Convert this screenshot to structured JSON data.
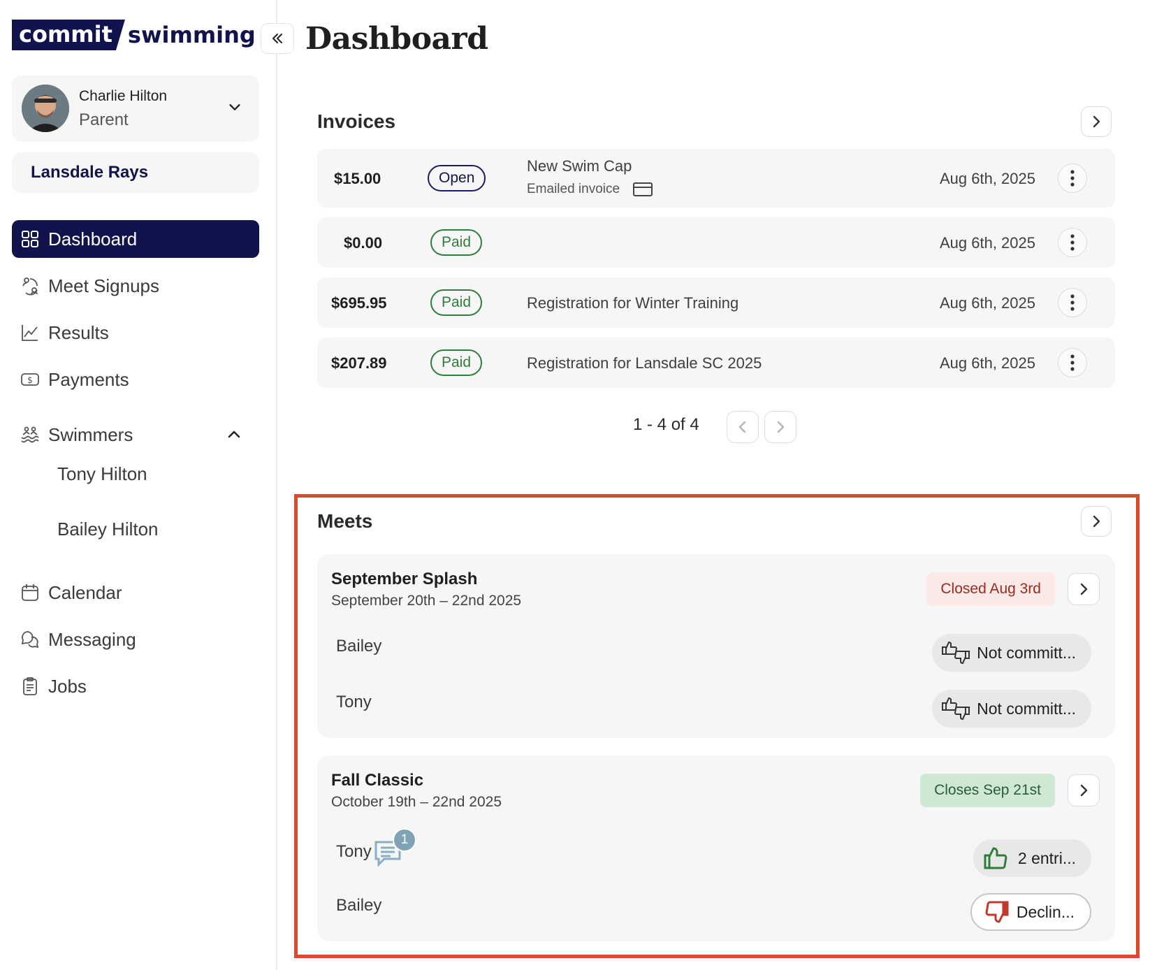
{
  "brand": {
    "logo_left": "commit",
    "logo_right": "swimming"
  },
  "sidebar": {
    "collapse_icon": "double-chevron-left-icon",
    "user": {
      "name": "Charlie Hilton",
      "role": "Parent"
    },
    "team": "Lansdale Rays",
    "nav": [
      {
        "label": "Dashboard",
        "icon": "grid-icon",
        "active": true
      },
      {
        "label": "Meet Signups",
        "icon": "signup-icon"
      },
      {
        "label": "Results",
        "icon": "chart-icon"
      },
      {
        "label": "Payments",
        "icon": "dollar-icon"
      },
      {
        "label": "Swimmers",
        "icon": "swimmers-icon"
      },
      {
        "label": "Calendar",
        "icon": "calendar-icon"
      },
      {
        "label": "Messaging",
        "icon": "chat-icon"
      },
      {
        "label": "Jobs",
        "icon": "clipboard-icon"
      }
    ],
    "swimmers": [
      "Tony Hilton",
      "Bailey Hilton"
    ]
  },
  "page": {
    "title": "Dashboard"
  },
  "invoices": {
    "title": "Invoices",
    "rows": [
      {
        "amount": "$15.00",
        "status": "Open",
        "description": "New Swim Cap",
        "sub": "Emailed invoice",
        "date": "Aug 6th, 2025"
      },
      {
        "amount": "$0.00",
        "status": "Paid",
        "description": "",
        "sub": "",
        "date": "Aug 6th, 2025"
      },
      {
        "amount": "$695.95",
        "status": "Paid",
        "description": "Registration for Winter Training",
        "sub": "",
        "date": "Aug 6th, 2025"
      },
      {
        "amount": "$207.89",
        "status": "Paid",
        "description": "Registration for Lansdale SC 2025",
        "sub": "",
        "date": "Aug 6th, 2025"
      }
    ],
    "pagination": "1 - 4 of 4"
  },
  "meets": {
    "title": "Meets",
    "items": [
      {
        "name": "September Splash",
        "dates": "September 20th – 22nd 2025",
        "status": "Closed Aug 3rd",
        "swimmers": [
          {
            "name": "Bailey",
            "commitment": "Not committ..."
          },
          {
            "name": "Tony",
            "commitment": "Not committ..."
          }
        ]
      },
      {
        "name": "Fall Classic",
        "dates": "October 19th – 22nd 2025",
        "status": "Closes Sep 21st",
        "swimmers": [
          {
            "name": "Tony",
            "commitment": "2 entri...",
            "messages": "1"
          },
          {
            "name": "Bailey",
            "commitment": "Declin..."
          }
        ]
      }
    ]
  },
  "colors": {
    "brand_navy": "#11134d",
    "paid_green": "#2f7d3a",
    "highlight_red": "#e5452d",
    "declined_red": "#c0392b"
  }
}
